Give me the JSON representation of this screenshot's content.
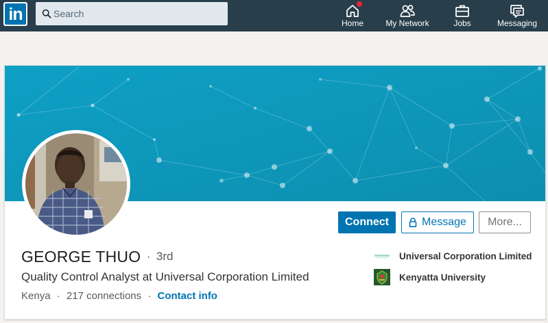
{
  "nav": {
    "logo_text": "in",
    "search_placeholder": "Search",
    "items": [
      {
        "label": "Home",
        "icon": "home-icon",
        "has_notification": true
      },
      {
        "label": "My Network",
        "icon": "network-icon"
      },
      {
        "label": "Jobs",
        "icon": "briefcase-icon"
      },
      {
        "label": "Messaging",
        "icon": "messaging-icon"
      }
    ]
  },
  "profile": {
    "name": "GEORGE THUO",
    "degree_separator": "·",
    "degree": "3rd",
    "headline": "Quality Control Analyst at Universal Corporation Limited",
    "location": "Kenya",
    "separator": "·",
    "connections": "217 connections",
    "contact_info_label": "Contact info"
  },
  "actions": {
    "connect_label": "Connect",
    "message_label": "Message",
    "more_label": "More..."
  },
  "experience": [
    {
      "label": "Universal Corporation Limited",
      "logo": "company-logo"
    },
    {
      "label": "Kenyatta University",
      "logo": "university-logo"
    }
  ],
  "colors": {
    "nav_background": "#283e4a",
    "brand_blue": "#0073b1",
    "banner_gradient_start": "#0fa2c7",
    "banner_gradient_end": "#0d8aa9",
    "notification_red": "#e6263a"
  }
}
